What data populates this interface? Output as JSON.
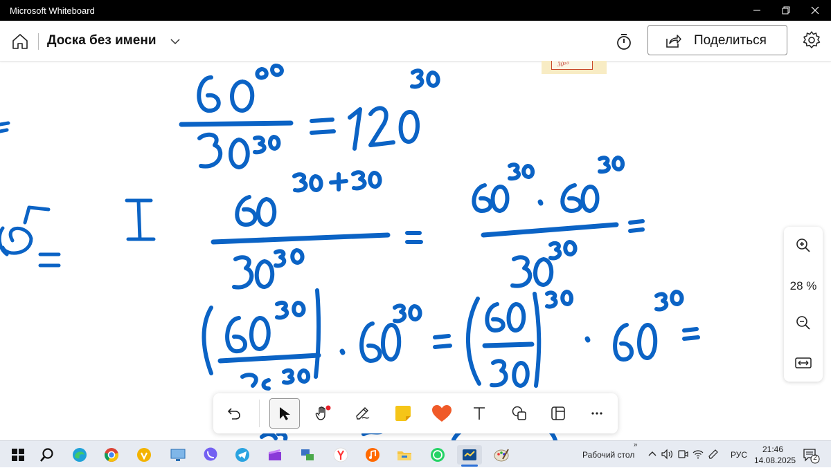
{
  "window": {
    "title": "Microsoft Whiteboard",
    "controls": [
      "minimize",
      "restore",
      "close"
    ]
  },
  "appbar": {
    "board_title": "Доска без имени",
    "share_label": "Поделиться"
  },
  "canvas": {
    "ink_color": "#0b63c5",
    "sticky_note_text": "30³⁰"
  },
  "zoom": {
    "level": "28 %"
  },
  "toolbar": {
    "tools": [
      "undo",
      "select",
      "pan",
      "pen",
      "sticky-note",
      "reactions",
      "text",
      "shapes",
      "templates",
      "more"
    ]
  },
  "taskbar": {
    "desktop_label": "Рабочий стол",
    "language": "РУС",
    "time": "21:46",
    "date": "14.08.2025",
    "notification_count": "2"
  }
}
